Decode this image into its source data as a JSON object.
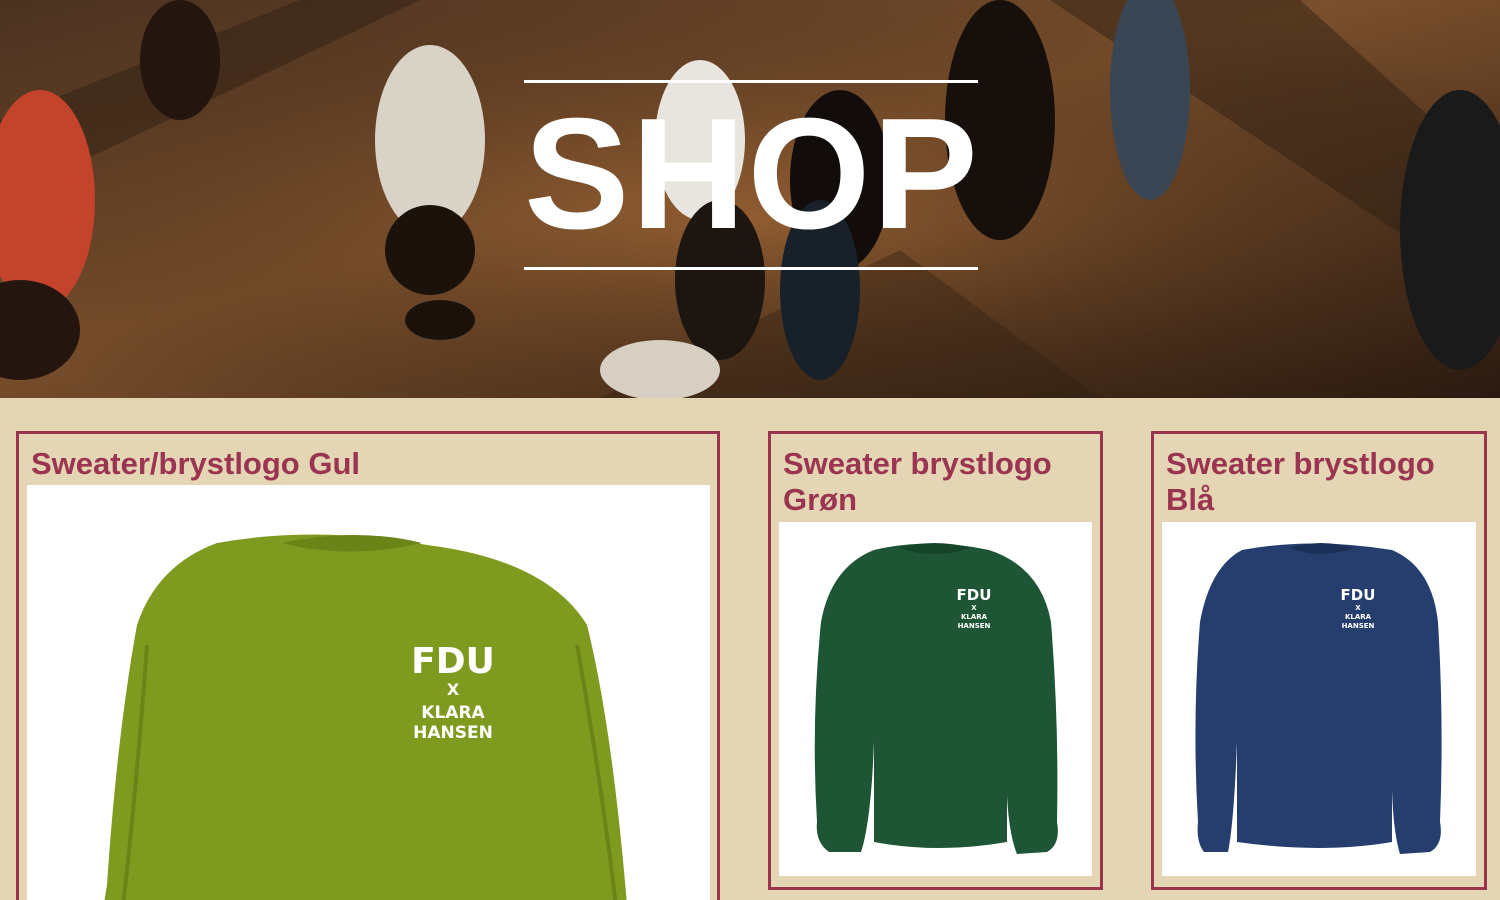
{
  "hero": {
    "title": "SHOP"
  },
  "products": [
    {
      "title": "Sweater/brystlogo Gul",
      "color": "#7f9b1f",
      "logo": [
        "FDU",
        "X",
        "KLARA",
        "HANSEN"
      ]
    },
    {
      "title": "Sweater brystlogo Grøn",
      "color": "#1d5535",
      "logo": [
        "FDU",
        "X",
        "KLARA",
        "HANSEN"
      ]
    },
    {
      "title": "Sweater brystlogo Blå",
      "color": "#263e6e",
      "logo": [
        "FDU",
        "X",
        "KLARA",
        "HANSEN"
      ]
    }
  ],
  "colors": {
    "accent": "#9a3450",
    "background": "#e4d5b5"
  }
}
